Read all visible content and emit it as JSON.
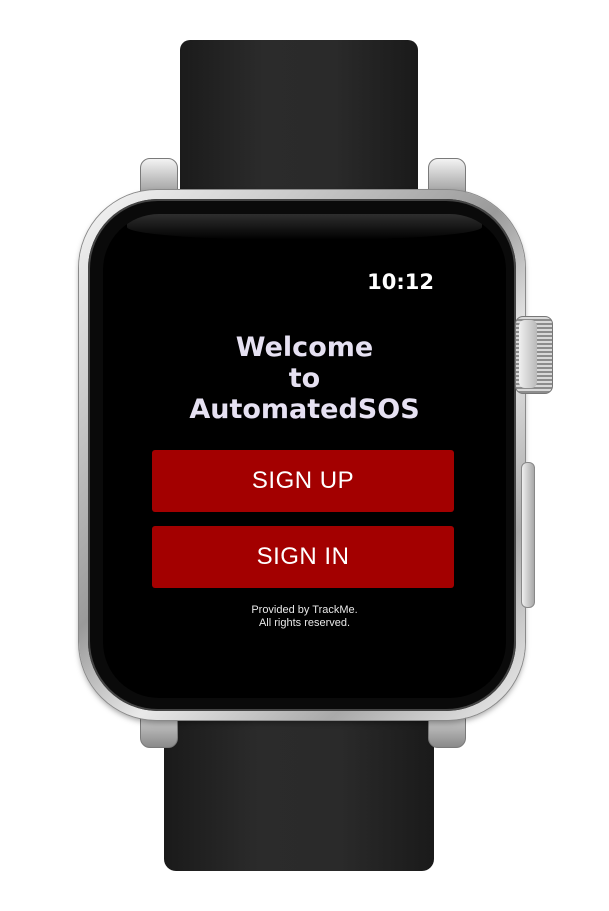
{
  "status": {
    "time": "10:12"
  },
  "welcome": {
    "line1": "Welcome",
    "line2": "to",
    "line3": "AutomatedSOS"
  },
  "buttons": {
    "sign_up": "SIGN UP",
    "sign_in": "SIGN IN"
  },
  "footer": {
    "line1": "Provided by TrackMe.",
    "line2": "All rights reserved."
  },
  "colors": {
    "button_red": "#a30000",
    "screen_bg": "#000000",
    "welcome_text": "#e6e1f2"
  }
}
